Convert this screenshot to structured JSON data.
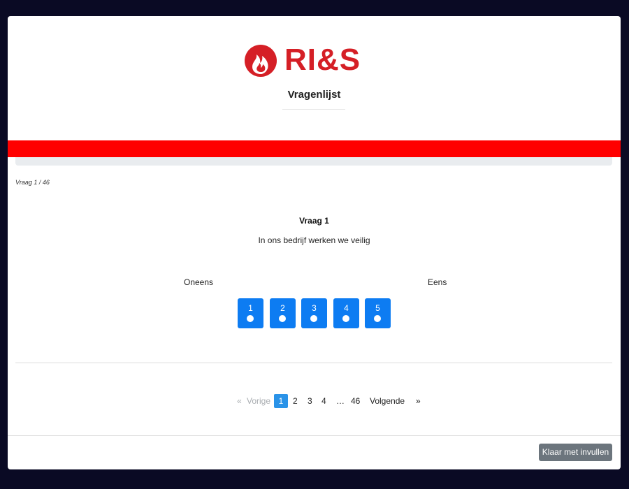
{
  "brand": {
    "logo_text": "RI&S",
    "primary_color": "#d51f26",
    "band_color": "#ff0000"
  },
  "page": {
    "title": "Vragenlijst",
    "counter": "Vraag 1 / 46"
  },
  "question": {
    "heading": "Vraag 1",
    "text": "In ons bedrijf werken we veilig",
    "scale_left": "Oneens",
    "scale_right": "Eens",
    "options": [
      "1",
      "2",
      "3",
      "4",
      "5"
    ],
    "option_color": "#0d7cf2"
  },
  "pagination": {
    "prev_arrow": "«",
    "prev_label": "Vorige",
    "pages": [
      "1",
      "2",
      "3",
      "4"
    ],
    "ellipsis": "…",
    "last_page": "46",
    "next_label": "Volgende",
    "next_arrow": "»",
    "active_page": "1"
  },
  "footer": {
    "done_label": "Klaar met invullen"
  }
}
